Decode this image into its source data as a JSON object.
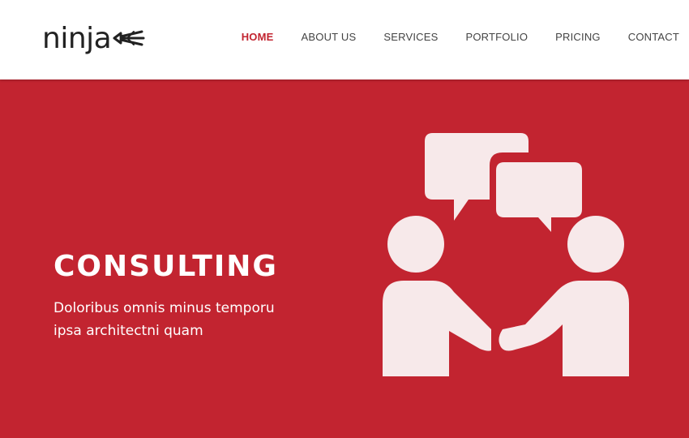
{
  "brand": {
    "logo_text": "ninja",
    "logo_icon": "arrow-icon"
  },
  "nav": {
    "items": [
      {
        "label": "HOME",
        "active": true
      },
      {
        "label": "ABOUT US",
        "active": false
      },
      {
        "label": "SERVICES",
        "active": false
      },
      {
        "label": "PORTFOLIO",
        "active": false
      },
      {
        "label": "PRICING",
        "active": false
      },
      {
        "label": "CONTACT",
        "active": false
      }
    ]
  },
  "hero": {
    "title": "CONSULTING",
    "text_line1": "Doloribus omnis minus temporu",
    "text_line2": "ipsa architectni quam",
    "illustration": "handshake-consulting-icon"
  },
  "colors": {
    "accent": "#c22430",
    "header_bg": "#ffffff",
    "icon_fill": "#f7e9ea",
    "nav_text": "#444444"
  }
}
